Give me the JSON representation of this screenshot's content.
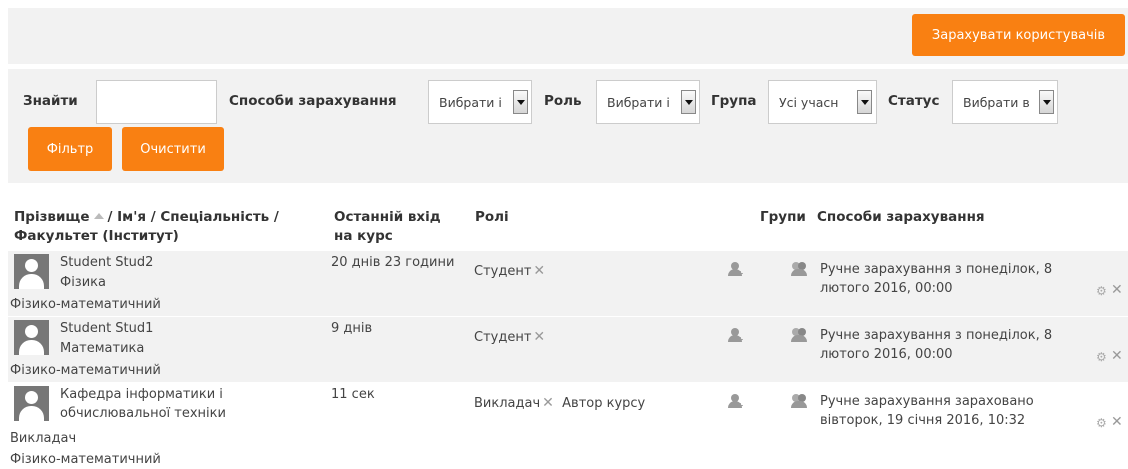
{
  "header": {
    "enrol_button": "Зарахувати користувачів"
  },
  "filters": {
    "search_label": "Знайти",
    "search_value": "",
    "methods_label": "Способи зарахування",
    "methods_value": "Вибрати і",
    "role_label": "Роль",
    "role_value": "Вибрати і",
    "group_label": "Група",
    "group_value": "Усі учасн",
    "status_label": "Статус",
    "status_value": "Вибрати в",
    "filter_button": "Фільтр",
    "clear_button": "Очистити"
  },
  "table": {
    "col_name_1": "Прізвище",
    "col_name_2": "/ Ім'я / Спеціальність /",
    "col_name_3": "Факультет (Інститут)",
    "col_lastaccess_1": "Останній вхід",
    "col_lastaccess_2": "на курс",
    "col_roles": "Ролі",
    "col_groups": "Групи",
    "col_methods": "Способи зарахування",
    "rows": [
      {
        "name": "Student Stud2",
        "specialty": "Фізика",
        "faculty": "Фізико-математичний",
        "last_access": "20 днів 23 години",
        "role": "Студент",
        "method_1": "Ручне зарахування з понеділок, 8",
        "method_2": "лютого 2016, 00:00"
      },
      {
        "name": "Student Stud1",
        "specialty": "Математика",
        "faculty": "Фізико-математичний",
        "last_access": "9 днів",
        "role": "Студент",
        "method_1": "Ручне зарахування з понеділок, 8",
        "method_2": "лютого 2016, 00:00"
      },
      {
        "name_1": "Кафедра інформатики і",
        "name_2": "обчислювальної техніки",
        "specialty": "Викладач",
        "faculty": "Фізико-математичний",
        "last_access": "11 сек",
        "role": "Викладач",
        "role_extra": "Автор курсу",
        "method_1": "Ручне зарахування зараховано",
        "method_2": "вівторок, 19 січня 2016, 10:32"
      }
    ]
  },
  "icons": {
    "add_role": "user-plus-icon",
    "groups": "users-icon",
    "edit": "gear-icon",
    "remove": "close-icon",
    "avatar": "user-avatar-icon",
    "sort": "sort-asc-icon"
  },
  "colors": {
    "accent": "#f98012",
    "panel": "#f2f2f2"
  }
}
